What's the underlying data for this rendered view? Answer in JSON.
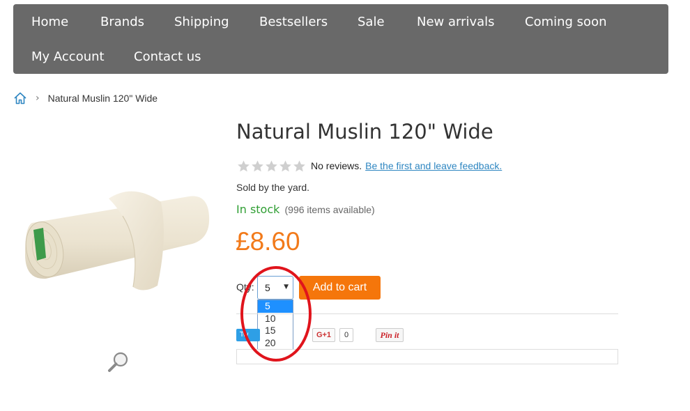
{
  "nav": {
    "items": [
      {
        "label": "Home"
      },
      {
        "label": "Brands"
      },
      {
        "label": "Shipping"
      },
      {
        "label": "Bestsellers"
      },
      {
        "label": "Sale"
      },
      {
        "label": "New arrivals"
      },
      {
        "label": "Coming soon"
      },
      {
        "label": "My Account"
      },
      {
        "label": "Contact us"
      }
    ]
  },
  "breadcrumb": {
    "home_icon": "home-icon",
    "separator": "›",
    "current": "Natural Muslin 120\" Wide"
  },
  "product": {
    "title": "Natural Muslin 120\" Wide",
    "rating": {
      "stars_filled": 0,
      "stars_total": 5
    },
    "no_reviews": "No reviews.",
    "feedback_link": "Be the first and leave feedback.",
    "sold_by": "Sold by the yard.",
    "stock_status": "In stock",
    "stock_count": "(996 items available)",
    "price": "£8.60"
  },
  "purchase": {
    "qty_label": "Qty:",
    "qty_selected": "5",
    "qty_options": [
      "5",
      "10",
      "15",
      "20"
    ],
    "add_to_cart": "Add to cart"
  },
  "social": {
    "tweet_label": "Tw",
    "gplus_label": "G+1",
    "gplus_count": "0",
    "pin_label": "Pin it"
  },
  "colors": {
    "nav_bg": "#696969",
    "price": "#f27a1a",
    "in_stock": "#2f9e33",
    "add_to_cart_bg": "#f5760b",
    "link": "#2e86c1",
    "annotation": "#e0141c"
  }
}
